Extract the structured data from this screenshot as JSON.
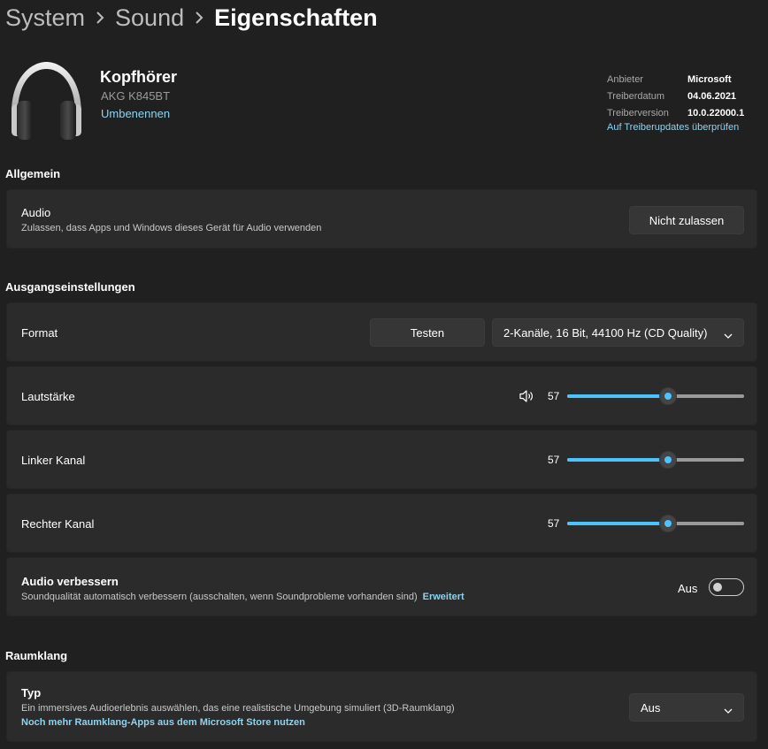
{
  "breadcrumb": {
    "items": [
      "System",
      "Sound"
    ],
    "current": "Eigenschaften"
  },
  "device": {
    "name": "Kopfhörer",
    "model": "AKG K845BT",
    "rename": "Umbenennen",
    "icon": "headphones-icon"
  },
  "driver": {
    "provider_label": "Anbieter",
    "provider_value": "Microsoft",
    "date_label": "Treiberdatum",
    "date_value": "04.06.2021",
    "version_label": "Treiberversion",
    "version_value": "10.0.22000.1",
    "update_link": "Auf Treiberupdates überprüfen"
  },
  "general": {
    "header": "Allgemein",
    "audio_title": "Audio",
    "audio_desc": "Zulassen, dass Apps und Windows dieses Gerät für Audio verwenden",
    "audio_button": "Nicht zulassen"
  },
  "output": {
    "header": "Ausgangseinstellungen",
    "format_label": "Format",
    "test_button": "Testen",
    "format_value": "2-Kanäle, 16 Bit, 44100 Hz (CD Quality)",
    "volume_label": "Lautstärke",
    "volume_value": "57",
    "left_label": "Linker Kanal",
    "left_value": "57",
    "right_label": "Rechter Kanal",
    "right_value": "57",
    "enhance_title": "Audio verbessern",
    "enhance_desc": "Soundqualität automatisch verbessern (ausschalten, wenn Soundprobleme vorhanden sind)",
    "enhance_link": "Erweitert",
    "enhance_state": "Aus"
  },
  "spatial": {
    "header": "Raumklang",
    "type_title": "Typ",
    "type_desc": "Ein immersives Audioerlebnis auswählen, das eine realistische Umgebung simuliert (3D-Raumklang)",
    "store_link": "Noch mehr Raumklang-Apps aus dem Microsoft Store nutzen",
    "type_value": "Aus"
  },
  "colors": {
    "accent": "#4cc2ff",
    "link": "#8fd3ef",
    "background": "#202020",
    "card": "#2b2b2b"
  }
}
